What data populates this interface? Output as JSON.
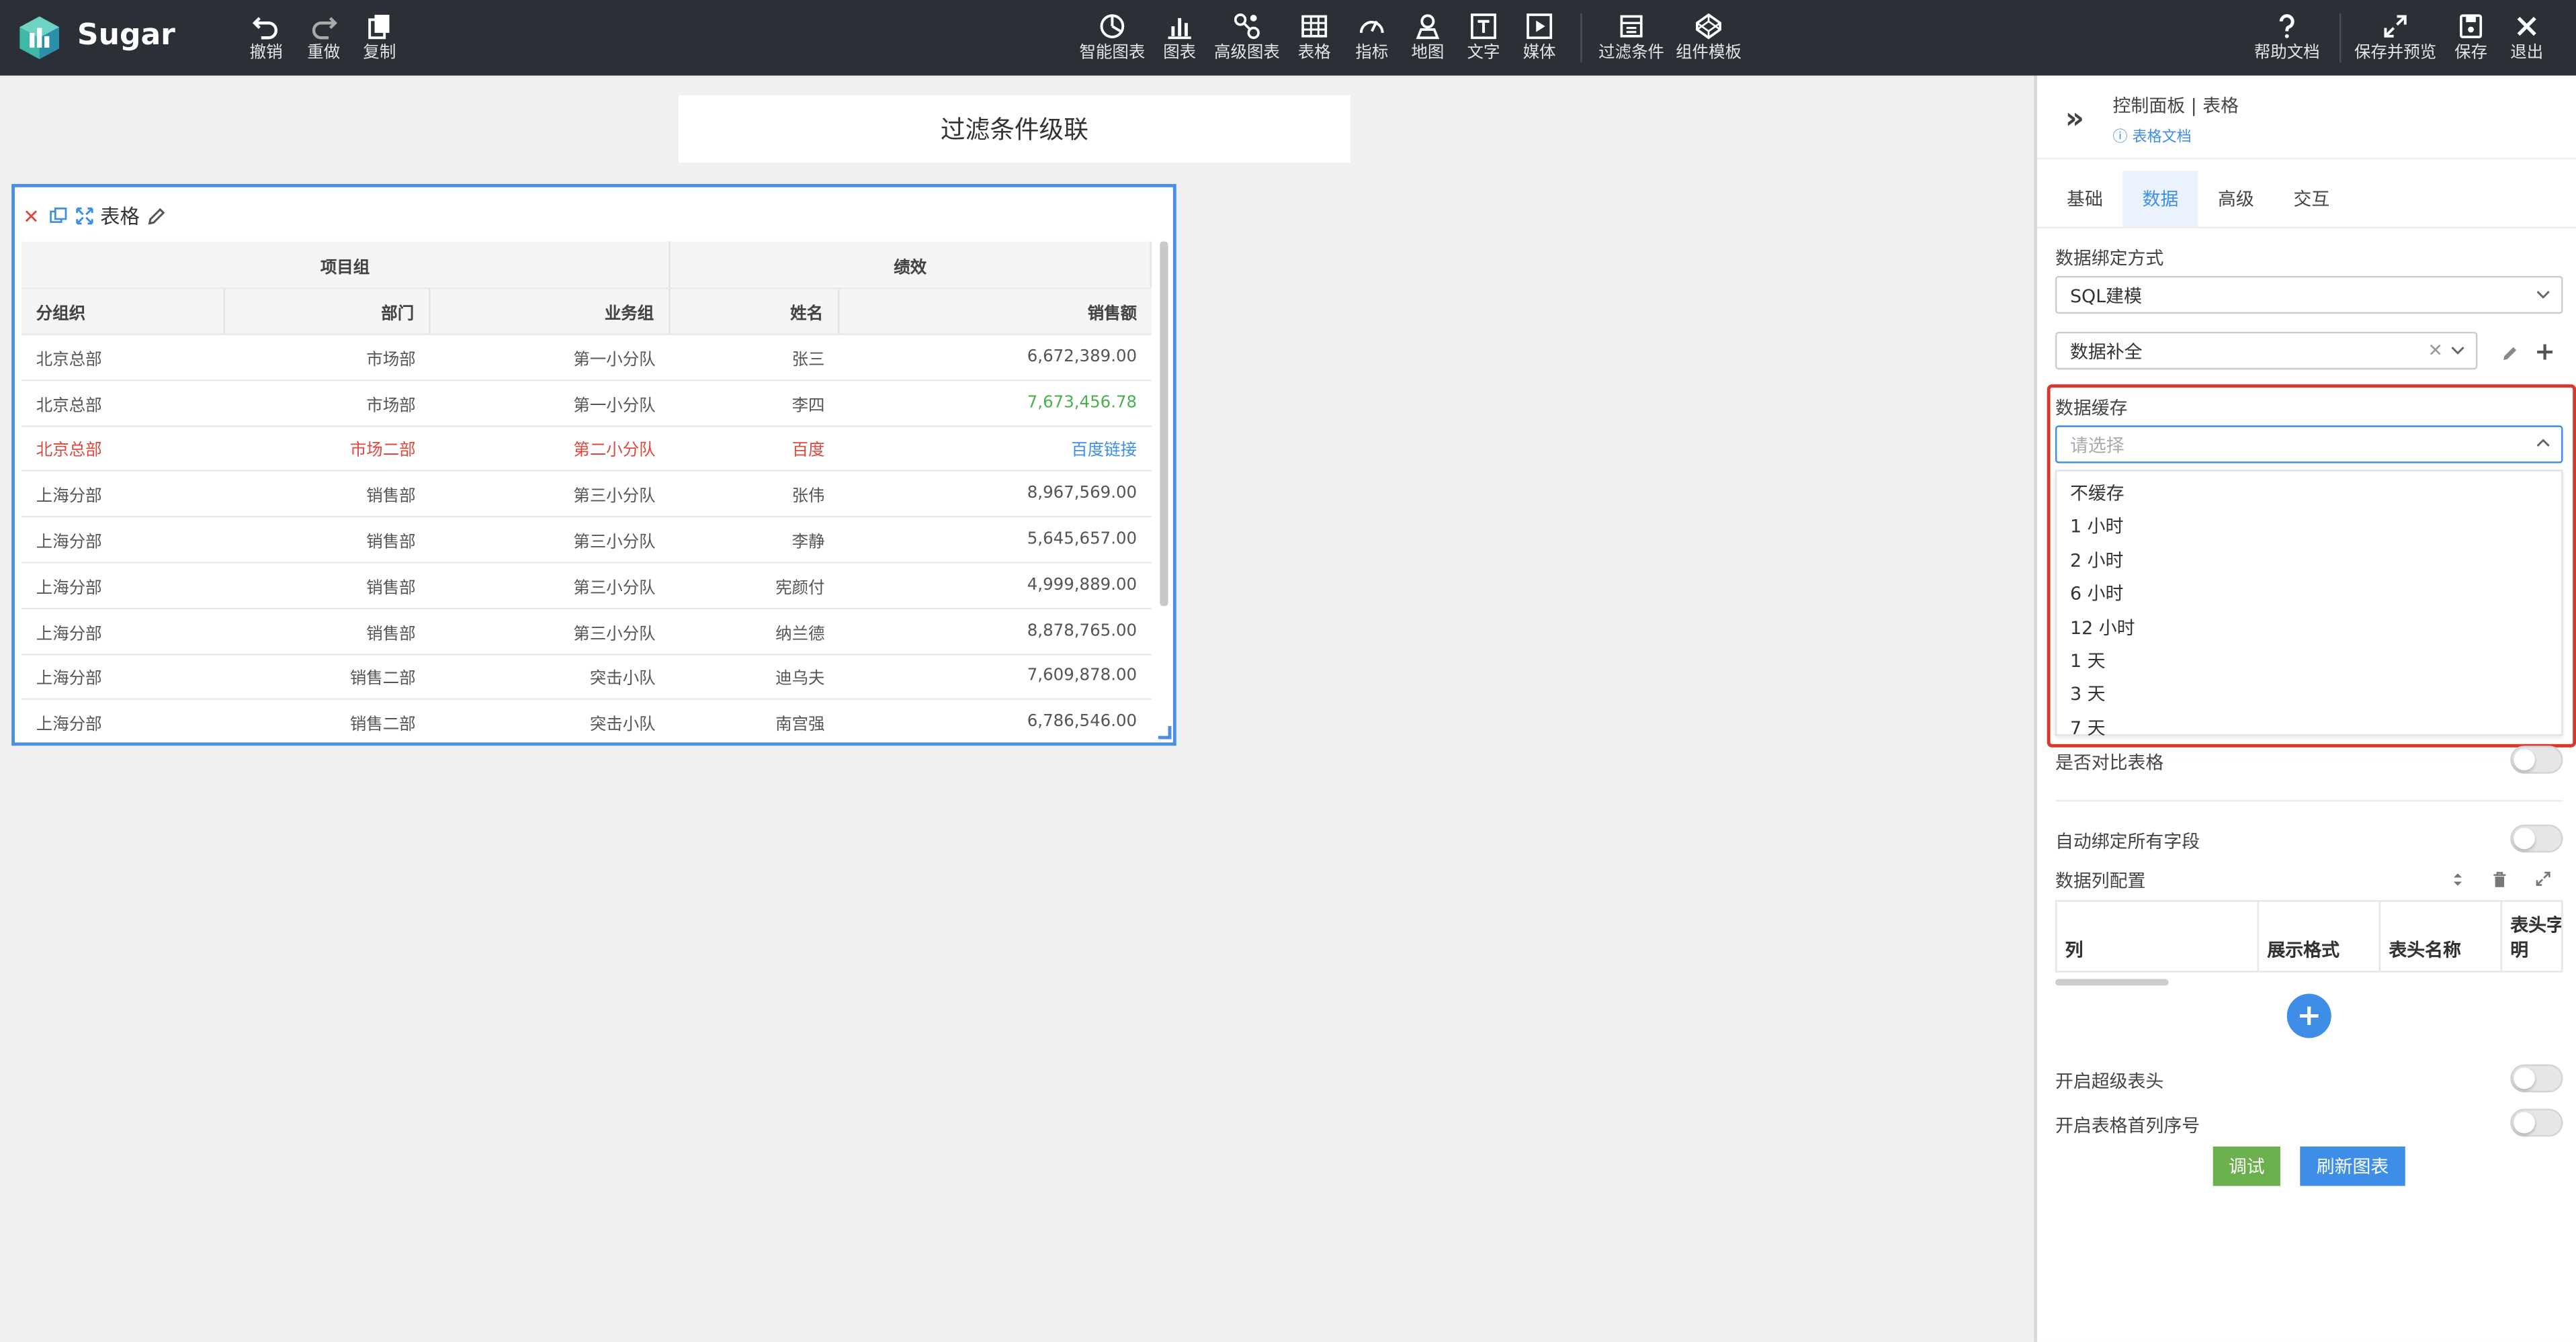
{
  "app": {
    "name": "Sugar"
  },
  "toolbar": {
    "left": [
      {
        "key": "undo",
        "label": "撤销"
      },
      {
        "key": "redo",
        "label": "重做"
      },
      {
        "key": "copy",
        "label": "复制"
      }
    ],
    "center": [
      {
        "key": "smart-chart",
        "label": "智能图表"
      },
      {
        "key": "chart",
        "label": "图表"
      },
      {
        "key": "advanced-chart",
        "label": "高级图表"
      },
      {
        "key": "table",
        "label": "表格"
      },
      {
        "key": "metric",
        "label": "指标"
      },
      {
        "key": "map",
        "label": "地图"
      },
      {
        "key": "text",
        "label": "文字"
      },
      {
        "key": "media",
        "label": "媒体"
      },
      {
        "key": "filter",
        "label": "过滤条件"
      },
      {
        "key": "template",
        "label": "组件模板"
      }
    ],
    "right": [
      {
        "key": "help",
        "label": "帮助文档"
      },
      {
        "key": "save-preview",
        "label": "保存并预览"
      },
      {
        "key": "save",
        "label": "保存"
      },
      {
        "key": "exit",
        "label": "退出"
      }
    ]
  },
  "canvas": {
    "title_card": "过滤条件级联",
    "widget": {
      "label": "表格",
      "group_headers": [
        "项目组",
        "绩效"
      ],
      "columns": [
        "分组织",
        "部门",
        "业务组",
        "姓名",
        "销售额"
      ],
      "rows": [
        {
          "cells": [
            "北京总部",
            "市场部",
            "第一小分队",
            "张三",
            "6,672,389.00"
          ],
          "style": "normal"
        },
        {
          "cells": [
            "北京总部",
            "市场部",
            "第一小分队",
            "李四",
            "7,673,456.78"
          ],
          "style": "green-value"
        },
        {
          "cells": [
            "北京总部",
            "市场二部",
            "第二小分队",
            "百度",
            "百度链接"
          ],
          "style": "red-link"
        },
        {
          "cells": [
            "上海分部",
            "销售部",
            "第三小分队",
            "张伟",
            "8,967,569.00"
          ],
          "style": "normal"
        },
        {
          "cells": [
            "上海分部",
            "销售部",
            "第三小分队",
            "李静",
            "5,645,657.00"
          ],
          "style": "normal"
        },
        {
          "cells": [
            "上海分部",
            "销售部",
            "第三小分队",
            "宪颜付",
            "4,999,889.00"
          ],
          "style": "normal"
        },
        {
          "cells": [
            "上海分部",
            "销售部",
            "第三小分队",
            "纳兰德",
            "8,878,765.00"
          ],
          "style": "normal"
        },
        {
          "cells": [
            "上海分部",
            "销售二部",
            "突击小队",
            "迪乌夫",
            "7,609,878.00"
          ],
          "style": "normal"
        },
        {
          "cells": [
            "上海分部",
            "销售二部",
            "突击小队",
            "南宫强",
            "6,786,546.00"
          ],
          "style": "normal"
        }
      ]
    }
  },
  "panel": {
    "breadcrumb": "控制面板 | 表格",
    "doc_link": "表格文档",
    "tabs": [
      {
        "label": "基础",
        "active": false
      },
      {
        "label": "数据",
        "active": true
      },
      {
        "label": "高级",
        "active": false
      },
      {
        "label": "交互",
        "active": false
      }
    ],
    "binding": {
      "label": "数据绑定方式",
      "value": "SQL建模"
    },
    "completion": {
      "value": "数据补全"
    },
    "cache": {
      "label": "数据缓存",
      "placeholder": "请选择",
      "options": [
        "不缓存",
        "1 小时",
        "2 小时",
        "6 小时",
        "12 小时",
        "1 天",
        "3 天",
        "7 天"
      ]
    },
    "compare_table": {
      "label": "是否对比表格",
      "on": false
    },
    "auto_bind": {
      "label": "自动绑定所有字段",
      "on": false
    },
    "column_config": {
      "label": "数据列配置",
      "headers": [
        "列",
        "展示格式",
        "表头名称",
        "表头字段说明"
      ]
    },
    "super_header": {
      "label": "开启超级表头",
      "on": false
    },
    "first_col_index": {
      "label": "开启表格首列序号",
      "on": false
    },
    "buttons": {
      "debug": "调试",
      "refresh": "刷新图表"
    }
  },
  "colors": {
    "topbar": "#2b2f36",
    "accent": "#3e8ee8",
    "highlight": "#d9372e",
    "green_value": "#4caf50",
    "red_row": "#e0473c",
    "debug_button": "#6ab04c"
  }
}
